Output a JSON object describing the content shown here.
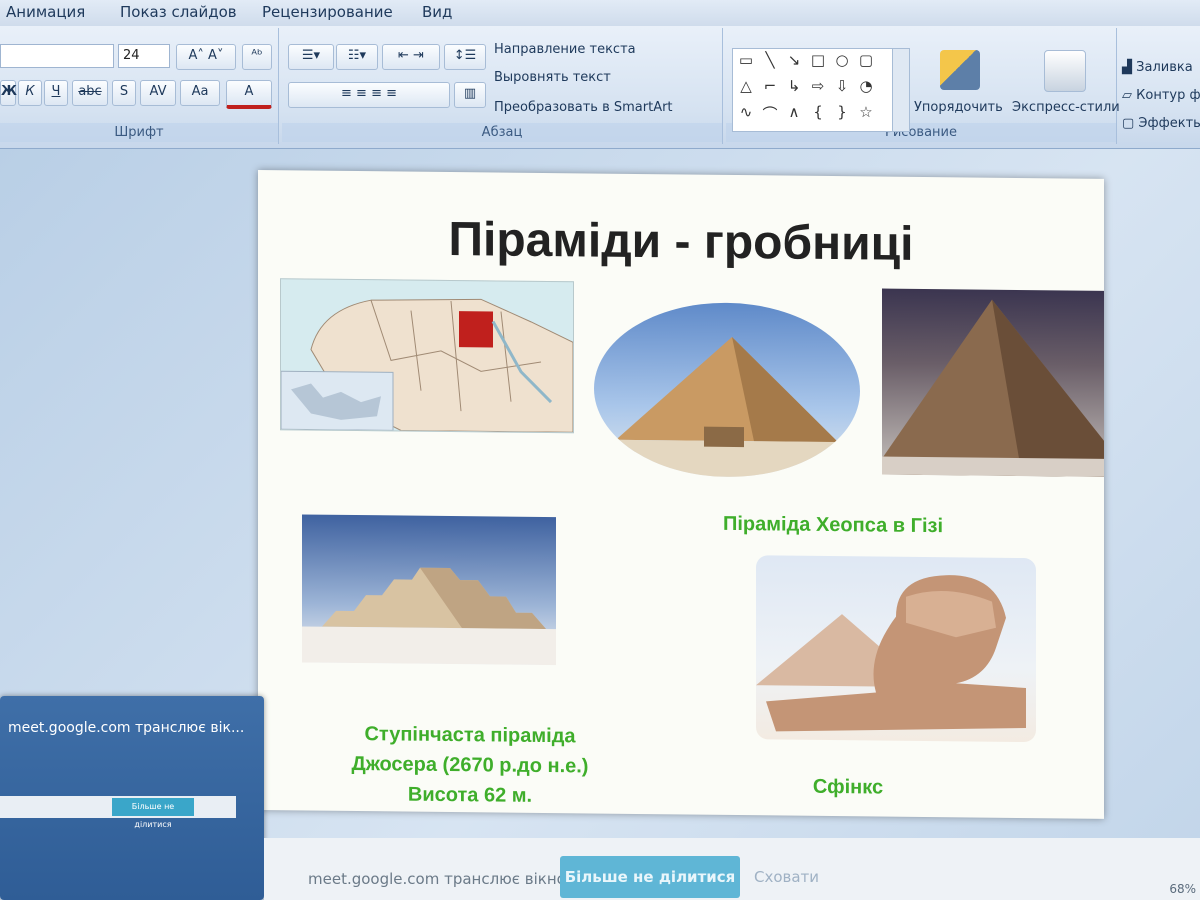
{
  "tabs": [
    "Анимация",
    "Показ слайдов",
    "Рецензирование",
    "Вид"
  ],
  "ribbon": {
    "font_size": "24",
    "font_group_label": "Шрифт",
    "paragraph_group_label": "Абзац",
    "drawing_group_label": "Рисование",
    "text_direction": "Направление текста",
    "align_text": "Выровнять текст",
    "convert_smartart": "Преобразовать в SmartArt",
    "arrange": "Упорядочить",
    "quick_styles": "Экспресс-стили",
    "fill": "Заливка",
    "outline": "Контур ф",
    "effects": "Эффекты",
    "font_buttons": [
      "Ж",
      "К",
      "Ч",
      "abc",
      "S",
      "AV",
      "Aa",
      "A"
    ]
  },
  "slide": {
    "title": "Піраміди - гробниці",
    "caption_cheops": "Піраміда Хеопса в Гізі",
    "caption_djoser_lines": [
      "Ступінчаста піраміда",
      "Джосера (2670 р.до н.е.)",
      "Висота 62 м."
    ],
    "caption_sphinx": "Сфінкс"
  },
  "meet": {
    "card_title": "meet.google.com транслює вік...",
    "card_button": "Більше не ділитися",
    "bar_text": "meet.google.com транслює вікно.",
    "stop_button": "Більше не ділитися",
    "hide_link": "Сховати"
  },
  "status": {
    "zoom": "68%"
  },
  "colors": {
    "caption_green": "#3fae2b",
    "ribbon_bg": "#d5e2f1",
    "egypt_red": "#c0201d"
  }
}
